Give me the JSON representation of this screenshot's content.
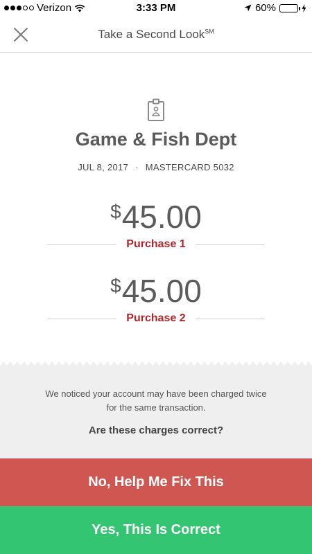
{
  "status_bar": {
    "carrier": "Verizon",
    "time": "3:33 PM",
    "battery_percent": "60%",
    "battery_level": 0.6,
    "icons": [
      "signal-dots-icon",
      "wifi-icon",
      "location-arrow-icon",
      "battery-icon",
      "charging-bolt-icon"
    ]
  },
  "header": {
    "title": "Take a Second Look",
    "title_mark": "SM",
    "close_icon": "close-icon"
  },
  "receipt": {
    "icon": "receipt-badge-icon",
    "merchant": "Game & Fish Dept",
    "date": "JUL 8, 2017",
    "separator": "·",
    "card": "MASTERCARD 5032",
    "charges": [
      {
        "currency": "$",
        "amount": "45.00",
        "label": "Purchase 1"
      },
      {
        "currency": "$",
        "amount": "45.00",
        "label": "Purchase 2"
      }
    ]
  },
  "info": {
    "notice": "We noticed your account may have been charged twice for the same transaction.",
    "question": "Are these charges correct?"
  },
  "actions": {
    "no_label": "No, Help Me Fix This",
    "yes_label": "Yes, This Is Correct"
  },
  "colors": {
    "accent_red": "#b3252b",
    "no_button": "#d05652",
    "yes_button": "#34c573",
    "battery": "#4cd964"
  }
}
